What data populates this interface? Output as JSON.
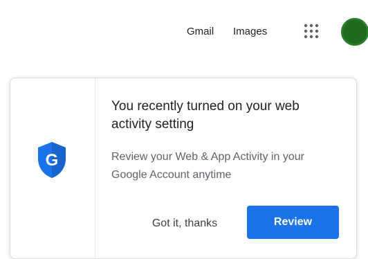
{
  "header": {
    "links": {
      "gmail": "Gmail",
      "images": "Images"
    },
    "apps_icon": "apps-grid-icon",
    "avatar_color": "#1e6a1e"
  },
  "promo_card": {
    "icon": "google-shield-icon",
    "icon_color": "#1a73e8",
    "title": "You recently turned on your web activity setting",
    "body": "Review your Web & App Activity in your Google Account anytime",
    "dismiss_label": "Got it, thanks",
    "review_label": "Review",
    "primary_color": "#1a73e8"
  }
}
